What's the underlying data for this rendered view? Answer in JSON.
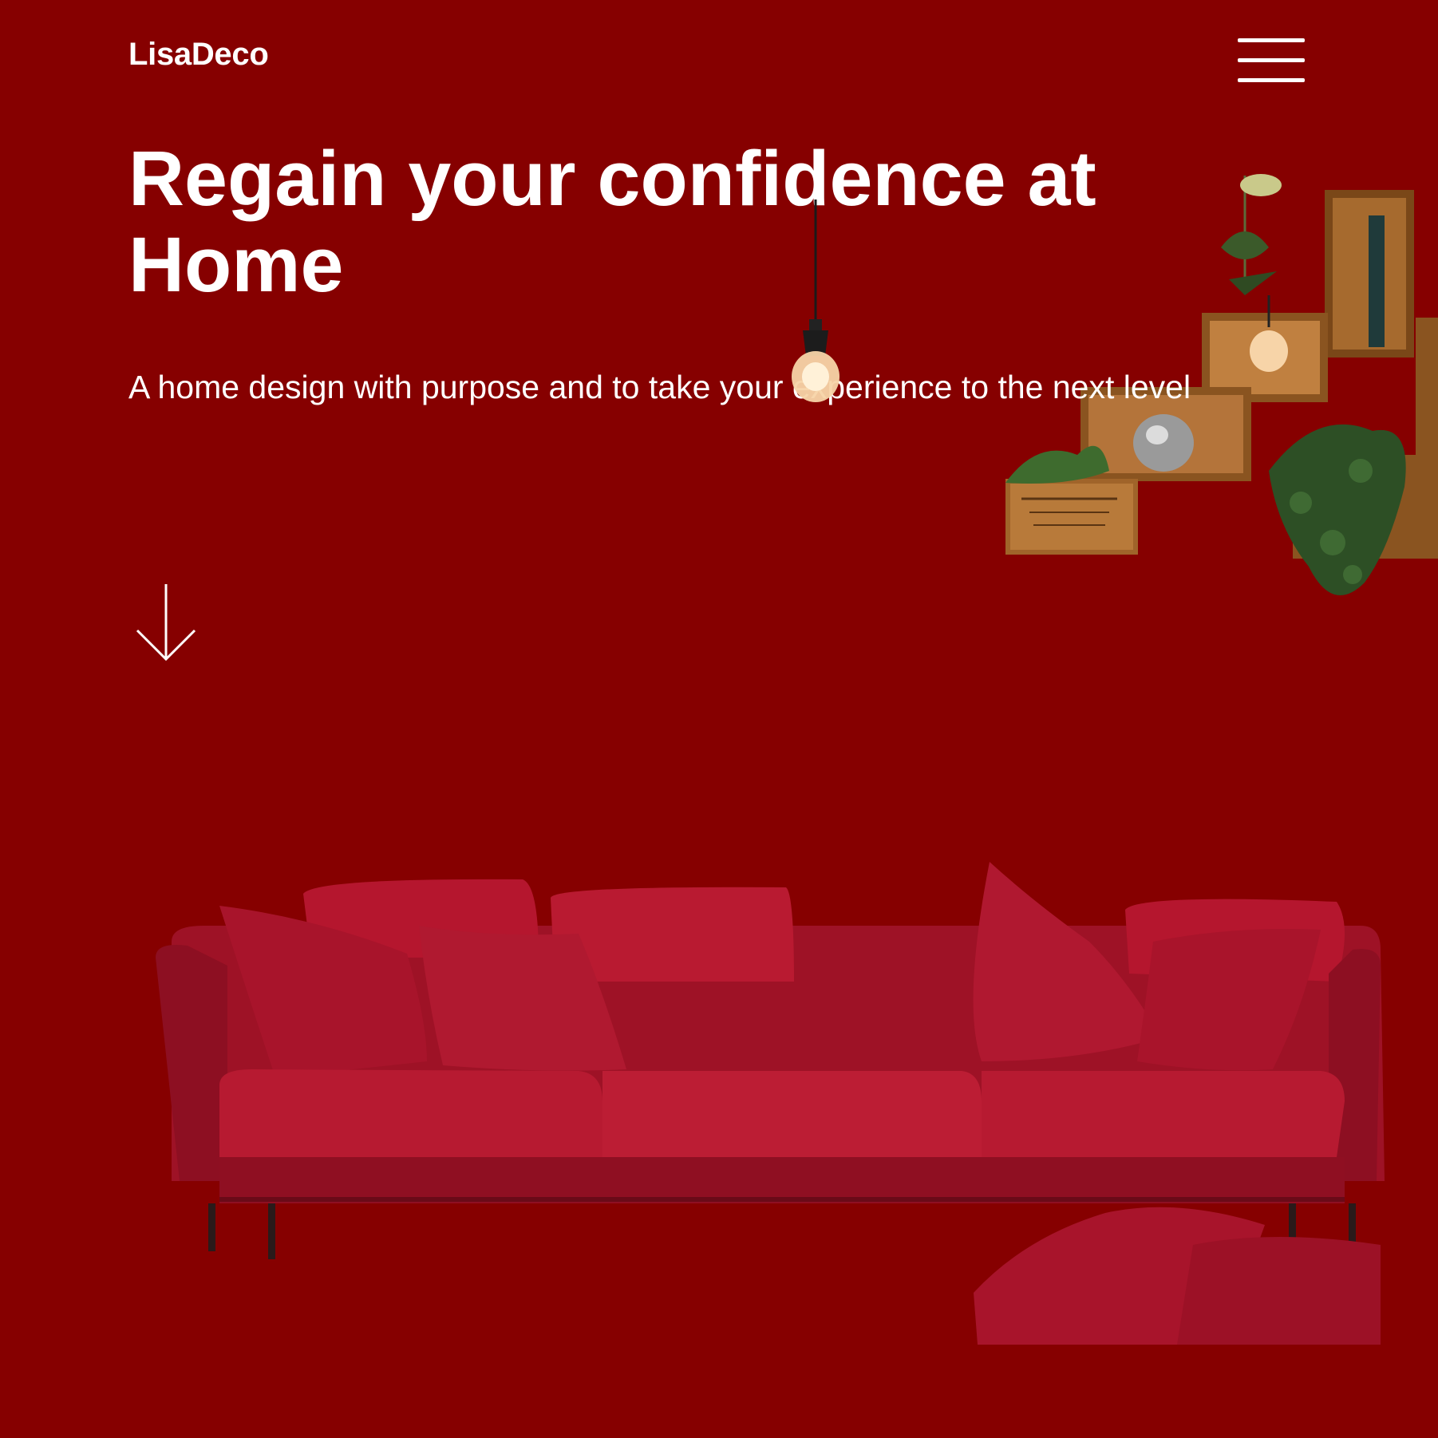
{
  "header": {
    "logo": "LisaDeco",
    "menu_icon": "hamburger-menu-icon"
  },
  "hero": {
    "title_line1": "Regain your confidence at",
    "title_line2": "Home",
    "subtitle": "A home design with purpose and to take your experience to the next level",
    "scroll_icon": "arrow-down-icon"
  },
  "colors": {
    "background": "#860000",
    "text": "#ffffff",
    "sofa": "#b5162e",
    "sofa_dark": "#8f0f22",
    "wood": "#a0642a"
  },
  "images": {
    "sofa": "red-sofa-image",
    "shelves": "wooden-crate-shelves-image",
    "lamp": "hanging-bulb-lamp-image"
  }
}
